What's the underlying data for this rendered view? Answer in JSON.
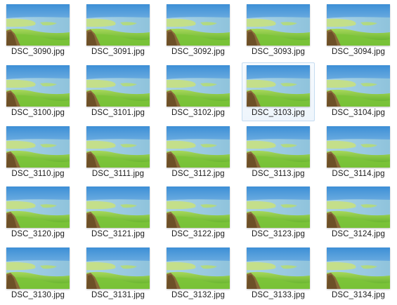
{
  "files": [
    {
      "name": "DSC_3090.jpg"
    },
    {
      "name": "DSC_3091.jpg"
    },
    {
      "name": "DSC_3092.jpg"
    },
    {
      "name": "DSC_3093.jpg"
    },
    {
      "name": "DSC_3094.jpg"
    },
    {
      "name": "DSC_3100.jpg"
    },
    {
      "name": "DSC_3101.jpg"
    },
    {
      "name": "DSC_3102.jpg"
    },
    {
      "name": "DSC_3103.jpg",
      "selected": true
    },
    {
      "name": "DSC_3104.jpg"
    },
    {
      "name": "DSC_3110.jpg"
    },
    {
      "name": "DSC_3111.jpg"
    },
    {
      "name": "DSC_3112.jpg"
    },
    {
      "name": "DSC_3113.jpg"
    },
    {
      "name": "DSC_3114.jpg"
    },
    {
      "name": "DSC_3120.jpg"
    },
    {
      "name": "DSC_3121.jpg"
    },
    {
      "name": "DSC_3122.jpg"
    },
    {
      "name": "DSC_3123.jpg"
    },
    {
      "name": "DSC_3124.jpg"
    },
    {
      "name": "DSC_3130.jpg"
    },
    {
      "name": "DSC_3131.jpg"
    },
    {
      "name": "DSC_3132.jpg"
    },
    {
      "name": "DSC_3133.jpg"
    },
    {
      "name": "DSC_3134.jpg"
    }
  ],
  "thumbnail_icon": "landscape-photo-thumbnail",
  "colors": {
    "selection_border": "#c5dcf0",
    "sky": "#3d8fd6",
    "water": "#8fc3dc",
    "grass": "#7cc43a"
  }
}
